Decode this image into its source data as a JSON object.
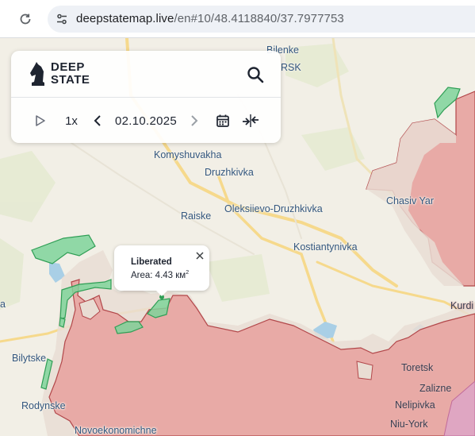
{
  "browser": {
    "url_domain": "deepstatemap.live",
    "url_path": "/en#10/48.4118840/37.7977753"
  },
  "panel": {
    "logo_line1": "DEEP",
    "logo_line2": "STATE",
    "speed_label": "1x",
    "date": "02.10.2025"
  },
  "popup": {
    "title": "Liberated",
    "area_label": "Area: 4.43 км",
    "area_sup": "2"
  },
  "places": [
    {
      "id": "bilenke",
      "name": "Bilenke"
    },
    {
      "id": "rsk",
      "name": "RSK"
    },
    {
      "id": "komyshuvakha",
      "name": "Komyshuvakha"
    },
    {
      "id": "druzhkivka",
      "name": "Druzhkivka"
    },
    {
      "id": "raiske",
      "name": "Raiske"
    },
    {
      "id": "oleksiievo",
      "name": "Oleksiievo-Druzhkivka"
    },
    {
      "id": "chasiv-yar",
      "name": "Chasiv Yar"
    },
    {
      "id": "kostiantynivka",
      "name": "Kostiantynivka"
    },
    {
      "id": "kurdi",
      "name": "Kurdi"
    },
    {
      "id": "bilytske",
      "name": "Bilytske"
    },
    {
      "id": "rodynske",
      "name": "Rodynske"
    },
    {
      "id": "novoekonomichne",
      "name": "Novoekonomichne"
    },
    {
      "id": "toretsk",
      "name": "Toretsk"
    },
    {
      "id": "zalizne",
      "name": "Zalizne"
    },
    {
      "id": "nelipivka",
      "name": "Nelipivka"
    },
    {
      "id": "niu-york",
      "name": "Niu-York"
    },
    {
      "id": "edge-a",
      "name": "a"
    }
  ],
  "colors": {
    "occupied": "#e8aaa6",
    "occupied_border": "#b2474a",
    "contested": "#e9ddd3",
    "liberated": "#7fd39a",
    "liberated_border": "#2f9e55",
    "road": "#f6d98c",
    "water": "#a9cfe6",
    "accent": "#1e2430"
  }
}
